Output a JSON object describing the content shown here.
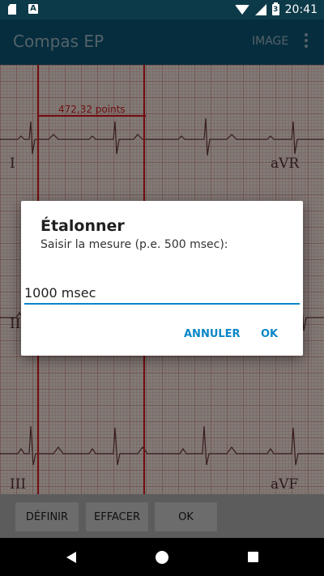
{
  "status_bar": {
    "time": "20:41",
    "battery_level": "3",
    "icons": [
      "sd-card-icon",
      "a-icon",
      "wifi-icon",
      "signal-icon",
      "battery-icon"
    ]
  },
  "app_bar": {
    "title": "Compas EP",
    "image_action": "IMAGE"
  },
  "ecg": {
    "measurement": "472,32 points",
    "leads": [
      "I",
      "aVR",
      "II",
      "III",
      "aVF"
    ]
  },
  "dialog": {
    "title": "Étalonner",
    "message": "Saisir la mesure (p.e. 500 msec):",
    "input_value": "1000 msec",
    "cancel_label": "ANNULER",
    "ok_label": "OK"
  },
  "toolbar": {
    "define_label": "DÉFINIR",
    "clear_label": "EFFACER",
    "ok_label": "OK"
  },
  "colors": {
    "app_bar": "#0b4c66",
    "accent": "#0a86c8",
    "caliper": "#c2141c"
  }
}
